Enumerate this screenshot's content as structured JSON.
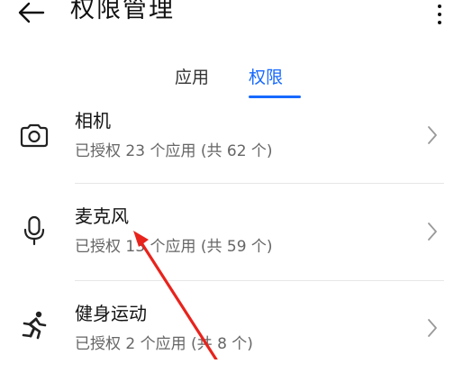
{
  "header": {
    "title": "权限管理"
  },
  "tabs": [
    {
      "label": "应用",
      "active": false
    },
    {
      "label": "权限",
      "active": true
    }
  ],
  "permissions": [
    {
      "name": "相机",
      "summary": "已授权 23 个应用 (共 62 个)",
      "icon": "camera-icon"
    },
    {
      "name": "麦克风",
      "summary": "已授权 13 个应用 (共 59 个)",
      "icon": "microphone-icon"
    },
    {
      "name": "健身运动",
      "summary": "已授权 2 个应用 (共 8 个)",
      "icon": "running-icon"
    }
  ],
  "colors": {
    "accent": "#1769ff",
    "annotation": "#e8231c"
  }
}
